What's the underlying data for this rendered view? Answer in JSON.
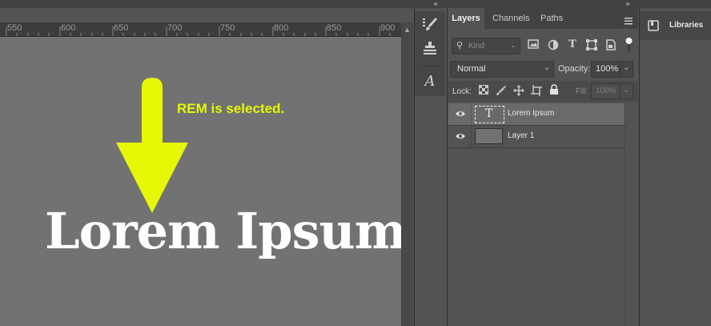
{
  "ruler": {
    "ticks": [
      "550",
      "600",
      "650",
      "700",
      "750",
      "800",
      "850",
      "900"
    ]
  },
  "canvas": {
    "annotation": "REM is selected.",
    "sample_text": "Lorem Ipsum",
    "arrow_color": "#e6f806",
    "text_color": "#ffffff"
  },
  "panel": {
    "tabs": [
      "Layers",
      "Channels",
      "Paths"
    ],
    "filter": {
      "placeholder": "Kind"
    },
    "blend_mode": "Normal",
    "opacity_label": "Opacity:",
    "opacity_value": "100%",
    "lock_label": "Lock:",
    "fill_label": "Fill:",
    "fill_value": "100%"
  },
  "layers": [
    {
      "name": "Lorem Ipsum",
      "kind": "type-layer",
      "selected": true
    },
    {
      "name": "Layer 1",
      "kind": "pixel-layer",
      "selected": false
    }
  ],
  "libraries": {
    "label": "Libraries"
  }
}
